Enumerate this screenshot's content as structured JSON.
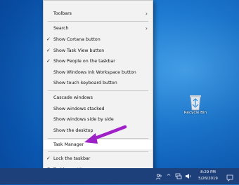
{
  "menu": {
    "toolbars": "Toolbars",
    "search": "Search",
    "show_cortana": "Show Cortana button",
    "show_task_view": "Show Task View button",
    "show_people": "Show People on the taskbar",
    "show_ink": "Show Windows Ink Workspace button",
    "show_touch_keyboard": "Show touch keyboard button",
    "cascade": "Cascade windows",
    "stacked": "Show windows stacked",
    "side_by_side": "Show windows side by side",
    "show_desktop": "Show the desktop",
    "task_manager": "Task Manager",
    "lock_taskbar": "Lock the taskbar",
    "taskbar_settings": "Taskbar settings"
  },
  "desktop": {
    "recycle_bin": "Recycle Bin"
  },
  "taskbar": {
    "time": "8:29 PM",
    "date": "5/26/2019"
  },
  "colors": {
    "accent_arrow": "#a020c8",
    "taskbar": "#1d3f7a"
  },
  "icons": [
    "chevron-right-icon",
    "check-icon",
    "gear-icon",
    "recycle-bin-icon",
    "people-icon",
    "chevron-up-icon",
    "network-icon",
    "volume-icon",
    "notification-icon"
  ]
}
